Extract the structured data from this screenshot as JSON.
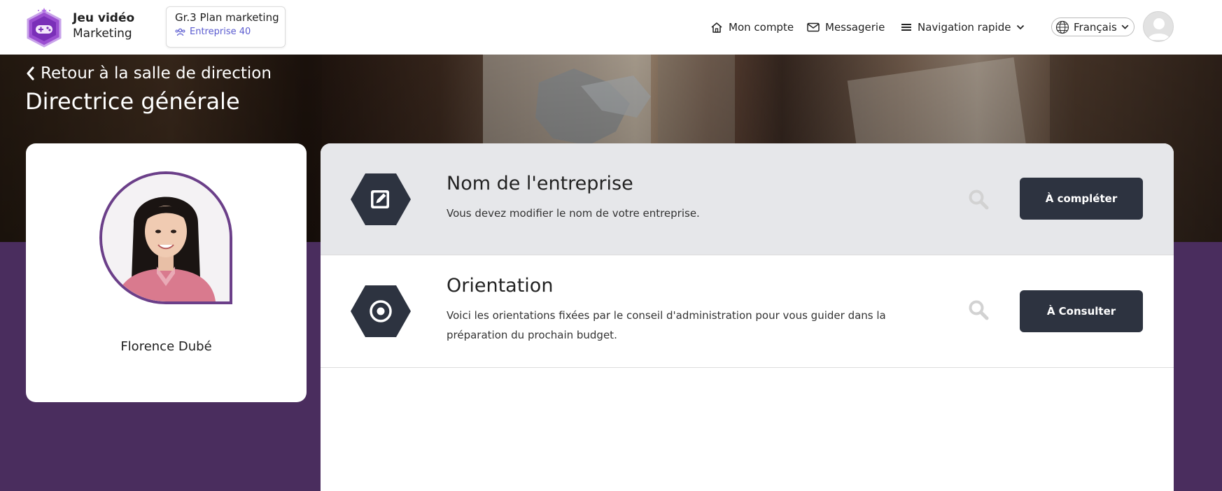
{
  "brand": {
    "line1": "Jeu vidéo",
    "line2": "Marketing",
    "logo_icon": "gamepad-hexagon-icon"
  },
  "game": {
    "title": "Gr.3 Plan marketing",
    "company": "Entreprise 40"
  },
  "nav": {
    "account": "Mon compte",
    "messages": "Messagerie",
    "quick_nav": "Navigation rapide"
  },
  "language": {
    "selected": "Français"
  },
  "page": {
    "back_label": "Retour à la salle de direction",
    "title": "Directrice générale"
  },
  "profile": {
    "name": "Florence Dubé"
  },
  "tasks": [
    {
      "title": "Nom de l'entreprise",
      "description": "Vous devez modifier le nom de votre entreprise.",
      "button": "À compléter",
      "icon": "edit-icon"
    },
    {
      "title": "Orientation",
      "description": "Voici les orientations fixées par le conseil d'administration pour vous guider dans la préparation du prochain budget.",
      "button": "À Consulter",
      "icon": "target-icon"
    }
  ],
  "colors": {
    "accent_purple": "#6b3f89",
    "dark_button": "#2d3340",
    "link_blue": "#5a5bd0",
    "page_purple": "#4a2d5e"
  }
}
